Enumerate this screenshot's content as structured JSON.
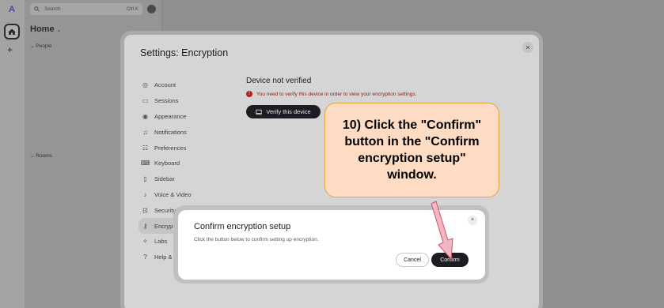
{
  "spaces": {
    "avatar_letter": "A",
    "add_symbol": "+"
  },
  "room_list": {
    "search_placeholder": "Search",
    "search_shortcut": "Ctrl K",
    "title": "Home",
    "section_people": "People",
    "section_rooms": "Rooms"
  },
  "settings": {
    "title": "Settings: Encryption",
    "close_symbol": "×",
    "nav": [
      {
        "label": "Account",
        "icon": "user-circle-icon"
      },
      {
        "label": "Sessions",
        "icon": "devices-icon"
      },
      {
        "label": "Appearance",
        "icon": "eye-icon"
      },
      {
        "label": "Notifications",
        "icon": "bell-icon"
      },
      {
        "label": "Preferences",
        "icon": "preferences-icon"
      },
      {
        "label": "Keyboard",
        "icon": "keyboard-icon"
      },
      {
        "label": "Sidebar",
        "icon": "sidebar-icon"
      },
      {
        "label": "Voice & Video",
        "icon": "microphone-icon"
      },
      {
        "label": "Security & Privacy",
        "icon": "lock-icon"
      },
      {
        "label": "Encryption",
        "icon": "key-icon"
      },
      {
        "label": "Labs",
        "icon": "labs-icon"
      },
      {
        "label": "Help & About",
        "icon": "help-icon"
      }
    ],
    "heading": "Device not verified",
    "warning": "You need to verify this device in order to view your encryption settings.",
    "verify_button": "Verify this device"
  },
  "callout": {
    "text": "10) Click the \"Confirm\" button in the \"Confirm encryption setup\" window."
  },
  "confirm_dialog": {
    "title": "Confirm encryption setup",
    "description": "Click the button below to confirm setting up encryption.",
    "cancel_label": "Cancel",
    "confirm_label": "Confirm",
    "close_symbol": "×"
  },
  "colors": {
    "accent_dark": "#1b1d22",
    "warning_red": "#b01f1f",
    "callout_bg": "#fddcc3",
    "callout_border": "#e4a53a",
    "arrow_fill": "#f4b6c2"
  }
}
